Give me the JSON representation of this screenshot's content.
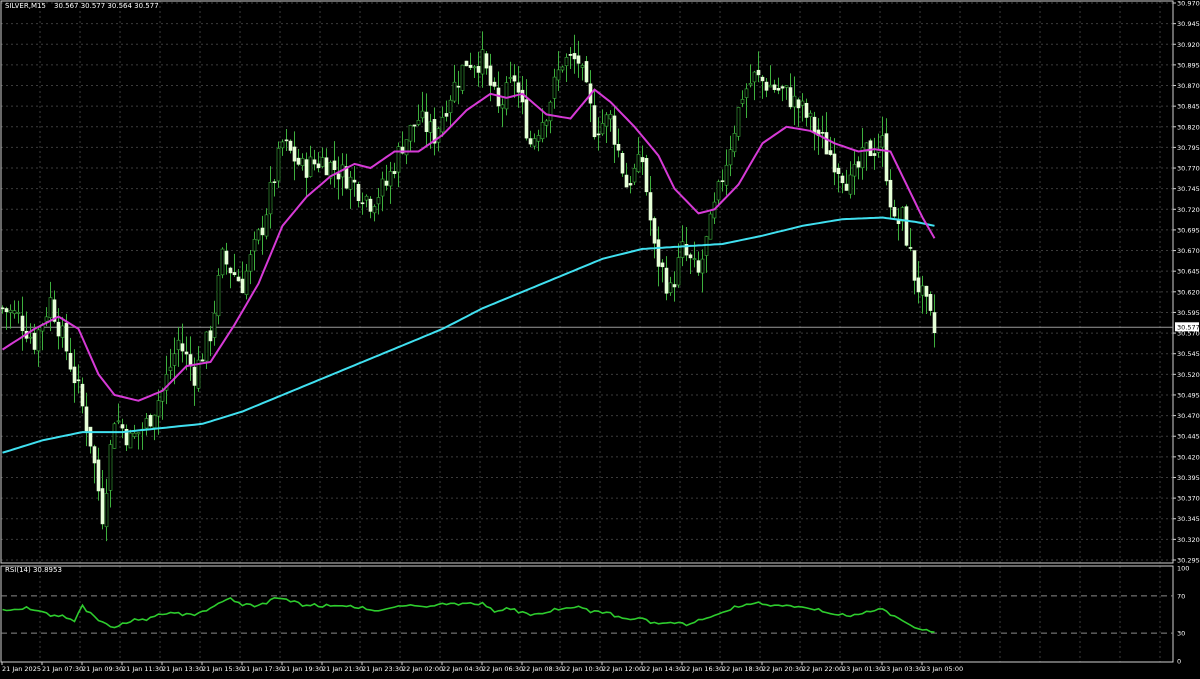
{
  "colors": {
    "background": "#000000",
    "grid": "#3c3c3c",
    "frame": "#d0d0d0",
    "text": "#ffffff",
    "candle_up_wick": "#3db03d",
    "candle_down_body": "#e6ffd8",
    "ma_fast": "#d63ad6",
    "ma_slow": "#40e0f0",
    "rsi_line": "#2ecc2e",
    "price_tag_bg": "#ffffff",
    "price_tag_text": "#000000"
  },
  "main_header": {
    "symbol_label": "SILVER,M15",
    "ohlc_text": "30.567 30.577 30.564 30.577"
  },
  "rsi_header": {
    "label": "RSI(14) 30.8953"
  },
  "price_axis": {
    "ticks": [
      "30.970",
      "30.945",
      "30.920",
      "30.895",
      "30.870",
      "30.845",
      "30.820",
      "30.795",
      "30.770",
      "30.745",
      "30.720",
      "30.695",
      "30.670",
      "30.645",
      "30.620",
      "30.595",
      "30.570",
      "30.545",
      "30.520",
      "30.495",
      "30.470",
      "30.445",
      "30.420",
      "30.395",
      "30.370",
      "30.345",
      "30.320",
      "30.295"
    ],
    "current_price": "30.577"
  },
  "rsi_axis": {
    "ticks": [
      "100",
      "70",
      "30",
      "0"
    ]
  },
  "time_axis": {
    "labels": [
      "21 Jan 2025",
      "21 Jan 07:30",
      "21 Jan 09:30",
      "21 Jan 11:30",
      "21 Jan 13:30",
      "21 Jan 15:30",
      "21 Jan 17:30",
      "21 Jan 19:30",
      "21 Jan 21:30",
      "21 Jan 23:30",
      "22 Jan 02:00",
      "22 Jan 04:30",
      "22 Jan 06:30",
      "22 Jan 08:30",
      "22 Jan 10:30",
      "22 Jan 12:00",
      "22 Jan 14:30",
      "22 Jan 16:30",
      "22 Jan 18:30",
      "22 Jan 20:30",
      "22 Jan 22:00",
      "23 Jan 01:30",
      "23 Jan 03:30",
      "23 Jan 05:00"
    ]
  },
  "chart_data": {
    "type": "candlestick",
    "symbol": "SILVER",
    "timeframe": "M15",
    "ylim": [
      30.295,
      30.97
    ],
    "rsi_ylim": [
      0,
      100
    ],
    "rsi_levels": [
      70,
      30
    ],
    "close_anchors": [
      [
        0,
        30.6
      ],
      [
        4,
        30.59
      ],
      [
        8,
        30.56
      ],
      [
        12,
        30.61
      ],
      [
        16,
        30.55
      ],
      [
        19,
        30.5
      ],
      [
        22,
        30.44
      ],
      [
        25,
        30.35
      ],
      [
        28,
        30.47
      ],
      [
        32,
        30.44
      ],
      [
        36,
        30.46
      ],
      [
        40,
        30.5
      ],
      [
        44,
        30.56
      ],
      [
        48,
        30.52
      ],
      [
        52,
        30.57
      ],
      [
        55,
        30.66
      ],
      [
        60,
        30.63
      ],
      [
        65,
        30.7
      ],
      [
        70,
        30.8
      ],
      [
        75,
        30.77
      ],
      [
        80,
        30.78
      ],
      [
        86,
        30.76
      ],
      [
        92,
        30.73
      ],
      [
        96,
        30.75
      ],
      [
        100,
        30.8
      ],
      [
        104,
        30.83
      ],
      [
        108,
        30.81
      ],
      [
        112,
        30.86
      ],
      [
        116,
        30.9
      ],
      [
        120,
        30.9
      ],
      [
        124,
        30.84
      ],
      [
        128,
        30.88
      ],
      [
        132,
        30.8
      ],
      [
        136,
        30.84
      ],
      [
        140,
        30.9
      ],
      [
        144,
        30.9
      ],
      [
        148,
        30.82
      ],
      [
        152,
        30.83
      ],
      [
        156,
        30.75
      ],
      [
        160,
        30.78
      ],
      [
        163,
        30.67
      ],
      [
        167,
        30.62
      ],
      [
        170,
        30.67
      ],
      [
        174,
        30.64
      ],
      [
        178,
        30.72
      ],
      [
        182,
        30.8
      ],
      [
        185,
        30.86
      ],
      [
        188,
        30.88
      ],
      [
        192,
        30.87
      ],
      [
        196,
        30.86
      ],
      [
        200,
        30.84
      ],
      [
        204,
        30.81
      ],
      [
        208,
        30.78
      ],
      [
        212,
        30.75
      ],
      [
        216,
        30.79
      ],
      [
        220,
        30.8
      ],
      [
        223,
        30.7
      ],
      [
        225,
        30.71
      ],
      [
        228,
        30.64
      ],
      [
        231,
        30.6
      ],
      [
        233,
        30.57
      ]
    ],
    "ma_fast_anchors": [
      [
        0,
        30.55
      ],
      [
        8,
        30.575
      ],
      [
        14,
        30.59
      ],
      [
        19,
        30.575
      ],
      [
        24,
        30.52
      ],
      [
        28,
        30.495
      ],
      [
        34,
        30.488
      ],
      [
        40,
        30.5
      ],
      [
        46,
        30.53
      ],
      [
        52,
        30.535
      ],
      [
        58,
        30.58
      ],
      [
        64,
        30.63
      ],
      [
        70,
        30.7
      ],
      [
        76,
        30.735
      ],
      [
        82,
        30.76
      ],
      [
        88,
        30.775
      ],
      [
        92,
        30.77
      ],
      [
        98,
        30.79
      ],
      [
        104,
        30.79
      ],
      [
        110,
        30.81
      ],
      [
        116,
        30.84
      ],
      [
        122,
        30.86
      ],
      [
        126,
        30.855
      ],
      [
        130,
        30.86
      ],
      [
        136,
        30.835
      ],
      [
        142,
        30.83
      ],
      [
        148,
        30.865
      ],
      [
        152,
        30.85
      ],
      [
        158,
        30.82
      ],
      [
        164,
        30.785
      ],
      [
        168,
        30.745
      ],
      [
        174,
        30.715
      ],
      [
        178,
        30.72
      ],
      [
        184,
        30.75
      ],
      [
        190,
        30.8
      ],
      [
        196,
        30.82
      ],
      [
        202,
        30.815
      ],
      [
        208,
        30.8
      ],
      [
        214,
        30.79
      ],
      [
        218,
        30.793
      ],
      [
        222,
        30.79
      ],
      [
        226,
        30.75
      ],
      [
        230,
        30.71
      ],
      [
        233,
        30.685
      ]
    ],
    "ma_slow_anchors": [
      [
        0,
        30.425
      ],
      [
        10,
        30.44
      ],
      [
        20,
        30.45
      ],
      [
        30,
        30.45
      ],
      [
        40,
        30.455
      ],
      [
        50,
        30.46
      ],
      [
        60,
        30.475
      ],
      [
        70,
        30.495
      ],
      [
        80,
        30.515
      ],
      [
        90,
        30.535
      ],
      [
        100,
        30.555
      ],
      [
        110,
        30.575
      ],
      [
        120,
        30.6
      ],
      [
        130,
        30.62
      ],
      [
        140,
        30.64
      ],
      [
        150,
        30.66
      ],
      [
        160,
        30.672
      ],
      [
        170,
        30.675
      ],
      [
        180,
        30.678
      ],
      [
        190,
        30.688
      ],
      [
        200,
        30.7
      ],
      [
        210,
        30.708
      ],
      [
        220,
        30.71
      ],
      [
        228,
        30.705
      ],
      [
        233,
        30.7
      ]
    ],
    "rsi_anchors": [
      [
        0,
        54
      ],
      [
        6,
        56
      ],
      [
        10,
        53
      ],
      [
        14,
        48
      ],
      [
        18,
        44
      ],
      [
        20,
        60
      ],
      [
        24,
        44
      ],
      [
        28,
        36
      ],
      [
        32,
        42
      ],
      [
        36,
        46
      ],
      [
        40,
        50
      ],
      [
        44,
        52
      ],
      [
        48,
        50
      ],
      [
        52,
        57
      ],
      [
        56,
        66
      ],
      [
        60,
        62
      ],
      [
        64,
        60
      ],
      [
        68,
        68
      ],
      [
        72,
        66
      ],
      [
        76,
        60
      ],
      [
        80,
        58
      ],
      [
        84,
        60
      ],
      [
        90,
        56
      ],
      [
        94,
        54
      ],
      [
        98,
        58
      ],
      [
        102,
        60
      ],
      [
        106,
        58
      ],
      [
        110,
        62
      ],
      [
        116,
        62
      ],
      [
        120,
        60
      ],
      [
        124,
        54
      ],
      [
        128,
        56
      ],
      [
        132,
        50
      ],
      [
        136,
        52
      ],
      [
        140,
        56
      ],
      [
        144,
        58
      ],
      [
        148,
        54
      ],
      [
        152,
        52
      ],
      [
        156,
        44
      ],
      [
        160,
        46
      ],
      [
        164,
        40
      ],
      [
        168,
        42
      ],
      [
        172,
        40
      ],
      [
        176,
        46
      ],
      [
        180,
        52
      ],
      [
        184,
        58
      ],
      [
        188,
        62
      ],
      [
        192,
        60
      ],
      [
        196,
        60
      ],
      [
        200,
        58
      ],
      [
        204,
        54
      ],
      [
        208,
        50
      ],
      [
        212,
        48
      ],
      [
        216,
        52
      ],
      [
        220,
        56
      ],
      [
        224,
        46
      ],
      [
        228,
        36
      ],
      [
        231,
        32
      ],
      [
        233,
        31
      ]
    ]
  }
}
